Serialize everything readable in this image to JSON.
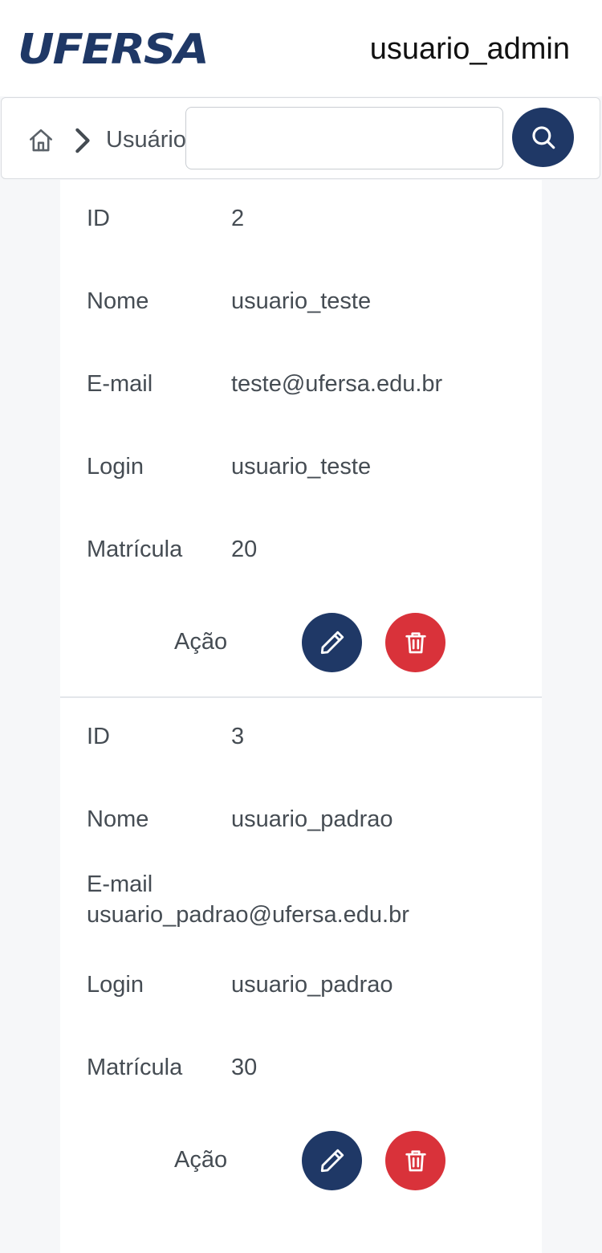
{
  "header": {
    "logo_text": "UFERSA",
    "username": "usuario_admin"
  },
  "toolbar": {
    "breadcrumb_home_icon": "home-icon",
    "breadcrumb_separator_icon": "chevron-right-icon",
    "breadcrumb_current": "Usuários",
    "search_value": "",
    "search_icon": "search-icon"
  },
  "colors": {
    "brand_navy": "#1f3866",
    "danger_red": "#d9323a",
    "page_bg": "#f6f7f9"
  },
  "records": [
    {
      "id_label": "ID",
      "id": "2",
      "nome_label": "Nome",
      "nome": "usuario_teste",
      "email_label": "E-mail",
      "email": "teste@ufersa.edu.br",
      "login_label": "Login",
      "login": "usuario_teste",
      "matricula_label": "Matrícula",
      "matricula": "20",
      "acao_label": "Ação"
    },
    {
      "id_label": "ID",
      "id": "3",
      "nome_label": "Nome",
      "nome": "usuario_padrao",
      "email_label": "E-mail",
      "email": "usuario_padrao@ufersa.edu.br",
      "login_label": "Login",
      "login": "usuario_padrao",
      "matricula_label": "Matrícula",
      "matricula": "30",
      "acao_label": "Ação"
    }
  ]
}
